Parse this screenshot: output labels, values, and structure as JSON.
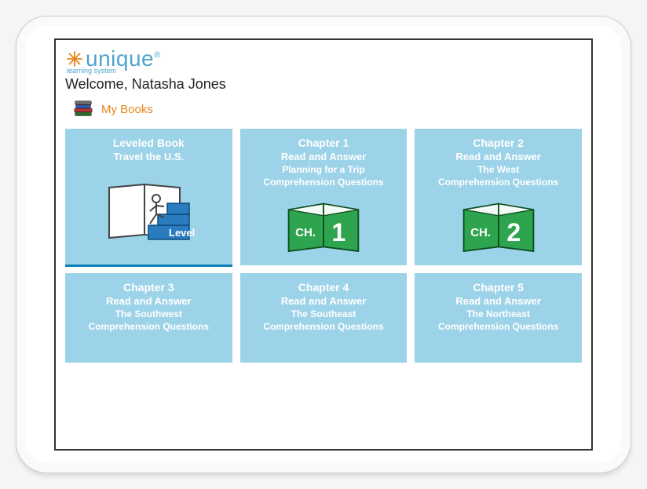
{
  "brand": {
    "name": "unique",
    "registered": "®",
    "subtitle": "learning system"
  },
  "welcome": "Welcome, Natasha Jones",
  "section": {
    "title": "My Books"
  },
  "tiles": [
    {
      "line1": "Leveled Book",
      "line2": "Travel the U.S.",
      "level_label": "Level"
    },
    {
      "line1": "Chapter 1",
      "line2": "Read and Answer",
      "line3": "Planning for a Trip",
      "line4": "Comprehension Questions",
      "ch_prefix": "CH.",
      "ch_num": "1"
    },
    {
      "line1": "Chapter 2",
      "line2": "Read and Answer",
      "line3": "The West",
      "line4": "Comprehension Questions",
      "ch_prefix": "CH.",
      "ch_num": "2"
    },
    {
      "line1": "Chapter 3",
      "line2": "Read and Answer",
      "line3": "The Southwest",
      "line4": "Comprehension Questions"
    },
    {
      "line1": "Chapter 4",
      "line2": "Read and Answer",
      "line3": "The Southeast",
      "line4": "Comprehension Questions"
    },
    {
      "line1": "Chapter 5",
      "line2": "Read and Answer",
      "line3": "The Northeast",
      "line4": "Comprehension Questions"
    }
  ],
  "colors": {
    "tile_bg": "#9dd3e8",
    "accent_blue": "#2b7cbf",
    "accent_orange": "#e8861a",
    "book_green": "#2fa44f"
  }
}
